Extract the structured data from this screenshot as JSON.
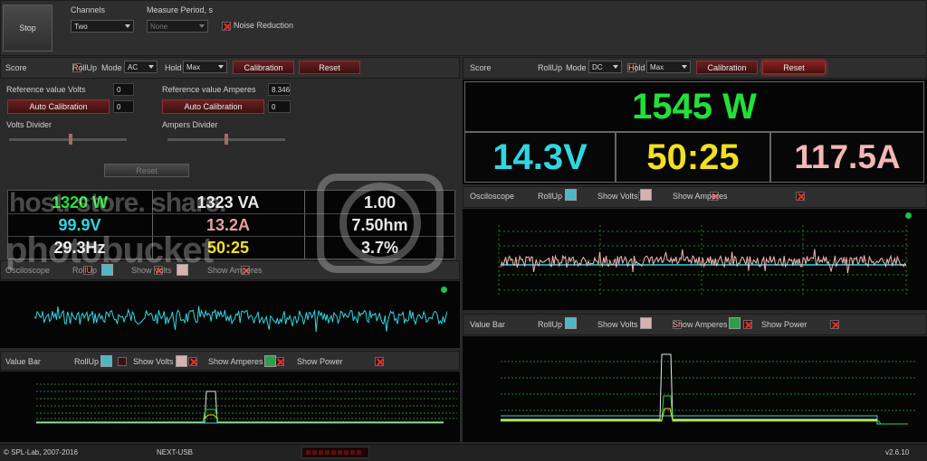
{
  "top": {
    "stop_label": "Stop",
    "channels_label": "Channels",
    "channels_value": "Two",
    "measure_label": "Measure Period, s",
    "measure_value": "None",
    "noise_label": "Noise Reduction"
  },
  "left": {
    "score_label": "Score",
    "rollup_label": "RollUp",
    "mode_label": "Mode",
    "mode_value": "AC",
    "hold_label": "Hold",
    "hold_value": "Max",
    "calibration_label": "Calibration",
    "reset_label": "Reset",
    "ref_volts_label": "Reference value Volts",
    "ref_volts_value": "0",
    "ref_amps_label": "Reference value Amperes",
    "ref_amps_value": "8.346",
    "auto_cal_label": "Auto Calibration",
    "auto_cal_v_value": "0",
    "auto_cal_a_value": "0",
    "volts_divider_label": "Volts Divider",
    "amps_divider_label": "Ampers Divider",
    "divider_reset_label": "Reset",
    "readings": {
      "power": "1320 W",
      "va": "1323 VA",
      "pf": "1.00",
      "volts": "99.9V",
      "amps": "13.2A",
      "ohm": "7.50hm",
      "hz": "29.3Hz",
      "time": "50:25",
      "pct": "3.7%"
    },
    "osc_label": "Osciloscope",
    "osc_rollup": "RollUp",
    "osc_show_volts": "Show Volts",
    "osc_show_amps": "Show Amperes",
    "vb_label": "Value Bar",
    "vb_rollup": "RollUp",
    "vb_show_volts": "Show Volts",
    "vb_show_amps": "Show Amperes",
    "vb_show_power": "Show Power"
  },
  "right": {
    "score_label": "Score",
    "rollup_label": "RollUp",
    "mode_label": "Mode",
    "mode_value": "DC",
    "hold_label": "Hold",
    "hold_value": "Max",
    "calibration_label": "Calibration",
    "reset_label": "Reset",
    "power": "1545 W",
    "volts": "14.3V",
    "time": "50:25",
    "amps": "117.5A",
    "osc_label": "Osciloscope",
    "osc_rollup": "RollUp",
    "osc_show_volts": "Show Volts",
    "osc_show_amps": "Show Amperes",
    "vb_label": "Value Bar",
    "vb_rollup": "RollUp",
    "vb_show_volts": "Show Volts",
    "vb_show_amps": "Show Amperes",
    "vb_show_power": "Show Power"
  },
  "watermark": "photobucket",
  "watermark_tagline": "host. store. share.",
  "status": {
    "copyright": "© SPL-Lab, 2007-2016",
    "device": "NEXT-USB",
    "version": "v2.6.10"
  },
  "colors": {
    "green": "#22e03a",
    "cyan": "#2fd6e0",
    "yellow": "#f0e020",
    "pink": "#f4b6b6",
    "red_btn": "#6b1f1f",
    "swatch_cyan": "#4fb6c6",
    "swatch_pink": "#d8b0b0",
    "swatch_green": "#2e9e4a"
  }
}
